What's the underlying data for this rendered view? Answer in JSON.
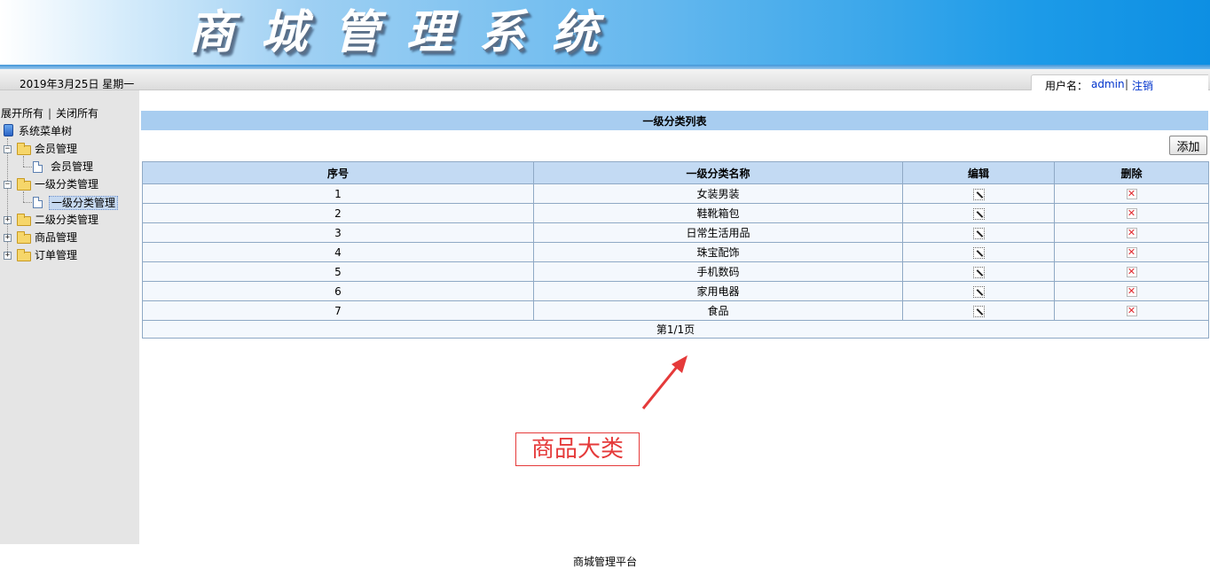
{
  "banner": {
    "title": "商城管理系统"
  },
  "status": {
    "date": "2019年3月25日 星期一",
    "user_label": "用户名：",
    "user_name": "admin",
    "separator": "|",
    "logout": "注销"
  },
  "tree": {
    "expand_all": "展开所有",
    "separator": "|",
    "collapse_all": "关闭所有",
    "root": "系统菜单树",
    "nodes": [
      {
        "label": "会员管理",
        "expanded": true,
        "children": [
          "会员管理"
        ]
      },
      {
        "label": "一级分类管理",
        "expanded": true,
        "children": [
          "一级分类管理"
        ]
      },
      {
        "label": "二级分类管理",
        "expanded": false
      },
      {
        "label": "商品管理",
        "expanded": false
      },
      {
        "label": "订单管理",
        "expanded": false
      }
    ]
  },
  "main": {
    "list_title": "一级分类列表",
    "add_label": "添加",
    "columns": [
      "序号",
      "一级分类名称",
      "编辑",
      "删除"
    ],
    "rows": [
      {
        "id": "1",
        "name": "女装男装"
      },
      {
        "id": "2",
        "name": "鞋靴箱包"
      },
      {
        "id": "3",
        "name": "日常生活用品"
      },
      {
        "id": "4",
        "name": "珠宝配饰"
      },
      {
        "id": "5",
        "name": "手机数码"
      },
      {
        "id": "6",
        "name": "家用电器"
      },
      {
        "id": "7",
        "name": "食品"
      }
    ],
    "pager": "第1/1页",
    "delete_glyph": "✕"
  },
  "annotation": {
    "label": "商品大类",
    "color": "#e53a3a"
  },
  "footer": {
    "text": "商城管理平台"
  }
}
